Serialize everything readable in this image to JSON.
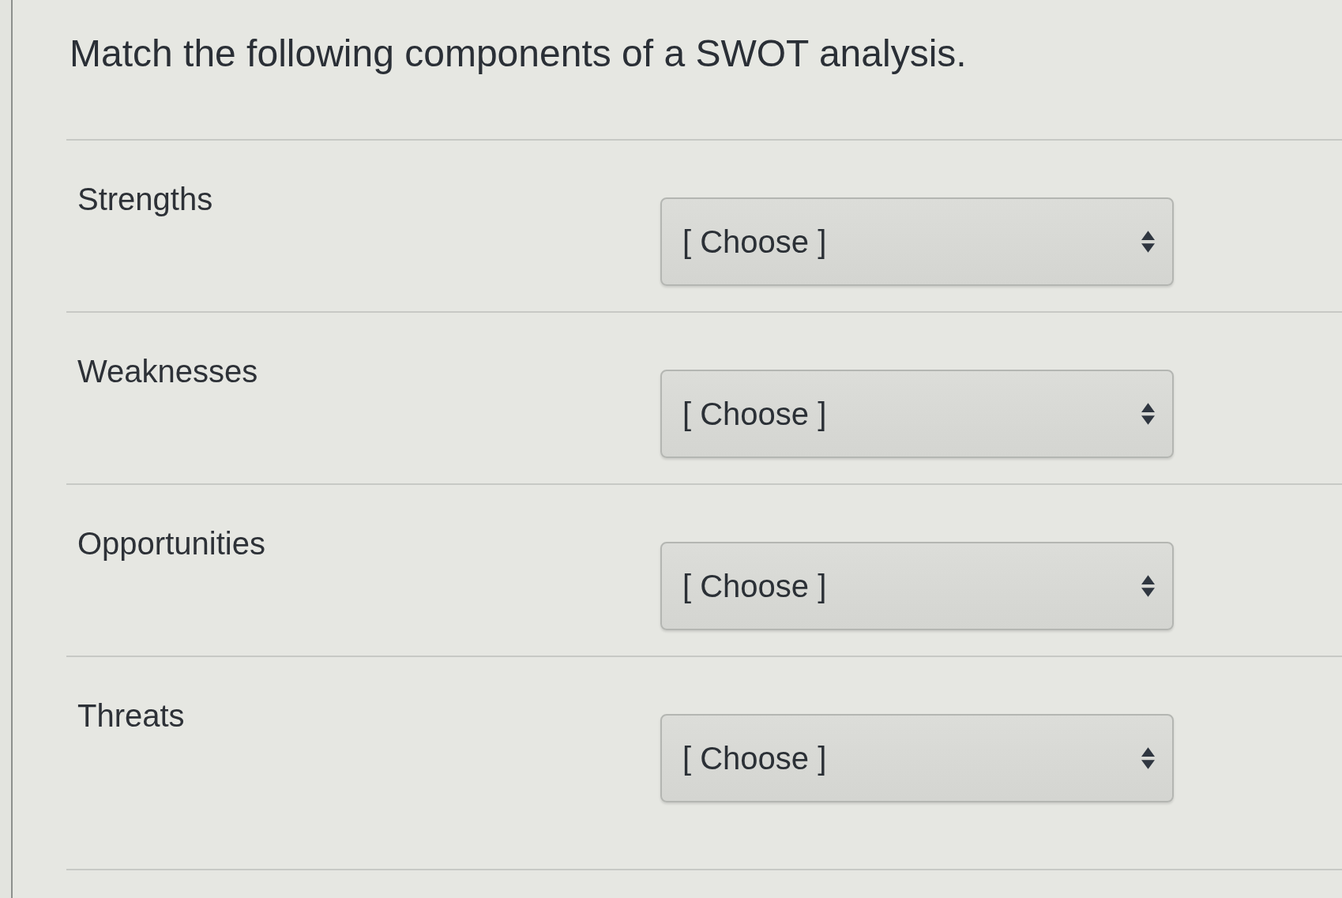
{
  "question": {
    "text": "Match the following components of a SWOT analysis."
  },
  "rows": [
    {
      "label": "Strengths",
      "dropdown": {
        "value": "[ Choose ]"
      }
    },
    {
      "label": "Weaknesses",
      "dropdown": {
        "value": "[ Choose ]"
      }
    },
    {
      "label": "Opportunities",
      "dropdown": {
        "value": "[ Choose ]"
      }
    },
    {
      "label": "Threats",
      "dropdown": {
        "value": "[ Choose ]"
      }
    }
  ]
}
